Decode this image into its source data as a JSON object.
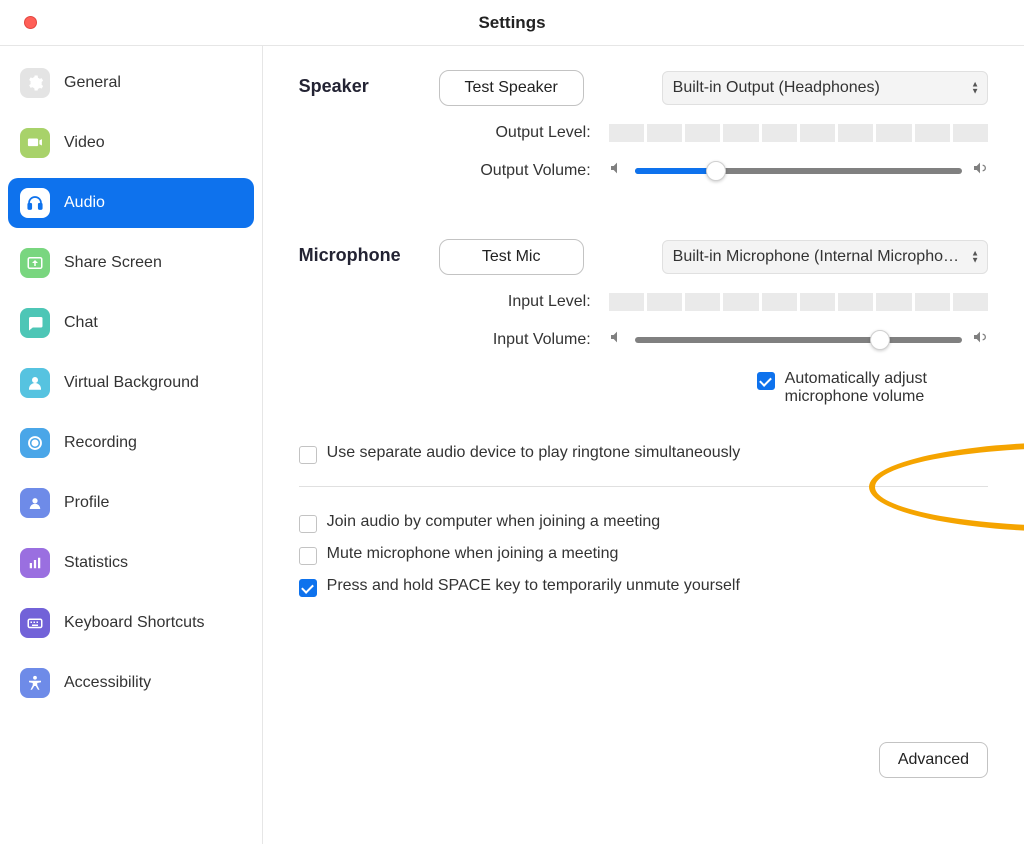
{
  "title": "Settings",
  "sidebar": {
    "items": [
      {
        "label": "General",
        "icon": "gear",
        "bg": "#e4e4e4",
        "fg": "#ffffff"
      },
      {
        "label": "Video",
        "icon": "camera",
        "bg": "#a8d26a",
        "fg": "#ffffff"
      },
      {
        "label": "Audio",
        "icon": "headphones",
        "bg": "#ffffff",
        "fg": "#0e72ed",
        "active": true
      },
      {
        "label": "Share Screen",
        "icon": "share",
        "bg": "#79d67f",
        "fg": "#ffffff"
      },
      {
        "label": "Chat",
        "icon": "chat",
        "bg": "#4dc6b6",
        "fg": "#ffffff"
      },
      {
        "label": "Virtual Background",
        "icon": "person",
        "bg": "#56c3e0",
        "fg": "#ffffff"
      },
      {
        "label": "Recording",
        "icon": "record",
        "bg": "#4aa6e8",
        "fg": "#ffffff"
      },
      {
        "label": "Profile",
        "icon": "avatar",
        "bg": "#6e8be8",
        "fg": "#ffffff"
      },
      {
        "label": "Statistics",
        "icon": "bars",
        "bg": "#9a6fe0",
        "fg": "#ffffff"
      },
      {
        "label": "Keyboard Shortcuts",
        "icon": "keyboard",
        "bg": "#7262d8",
        "fg": "#ffffff"
      },
      {
        "label": "Accessibility",
        "icon": "acc",
        "bg": "#6e8be8",
        "fg": "#ffffff"
      }
    ]
  },
  "audio": {
    "speaker": {
      "heading": "Speaker",
      "test_label": "Test Speaker",
      "device": "Built-in Output (Headphones)",
      "output_level_label": "Output Level:",
      "output_volume_label": "Output Volume:",
      "output_volume_percent": 25
    },
    "microphone": {
      "heading": "Microphone",
      "test_label": "Test Mic",
      "device": "Built-in Microphone (Internal Micropho…",
      "input_level_label": "Input Level:",
      "input_volume_label": "Input Volume:",
      "input_volume_percent": 75,
      "auto_adjust_label": "Automatically adjust microphone volume",
      "auto_adjust_checked": true
    },
    "options": {
      "separate_device_label": "Use separate audio device to play ringtone simultaneously",
      "separate_device_checked": false,
      "join_audio_label": "Join audio by computer when joining a meeting",
      "join_audio_checked": false,
      "mute_on_join_label": "Mute microphone when joining a meeting",
      "mute_on_join_checked": false,
      "space_unmute_label": "Press and hold SPACE key to temporarily unmute yourself",
      "space_unmute_checked": true
    },
    "advanced_label": "Advanced"
  }
}
